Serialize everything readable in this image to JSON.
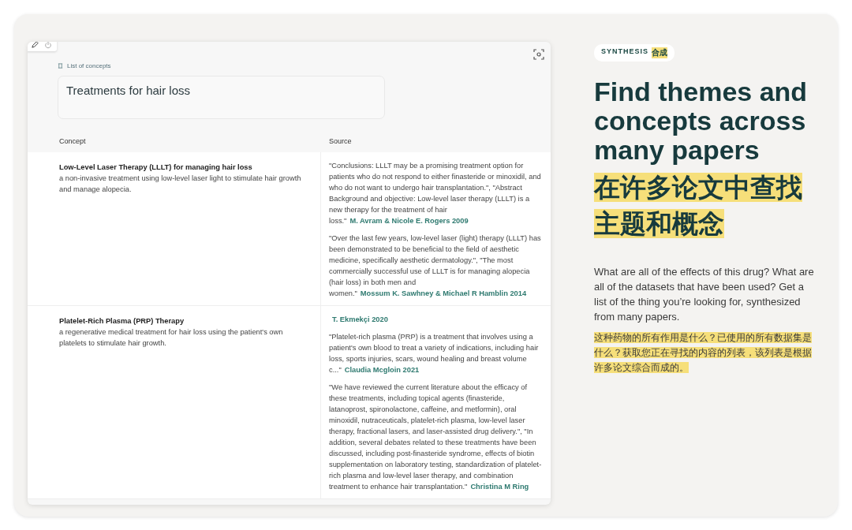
{
  "panel": {
    "breadcrumb": "List of concepts",
    "query": "Treatments for hair loss",
    "table": {
      "columns": [
        "Concept",
        "Source"
      ],
      "rows": [
        {
          "concept": "Low-Level Laser Therapy (LLLT) for managing hair loss",
          "description": "a non-invasive treatment using low-level laser light to stimulate hair growth and manage alopecia.",
          "sources": [
            {
              "quote": "\"Conclusions: LLLT may be a promising treatment option for patients who do not respond to either finasteride or minoxidil, and who do not want to undergo hair transplantation.\", \"Abstract Background and objective: Low-level laser therapy (LLLT) is a new therapy for the treatment of hair loss.\"",
              "author": "M. Avram & Nicole E. Rogers 2009"
            },
            {
              "quote": "\"Over the last few years, low-level laser (light) therapy (LLLT) has been demonstrated to be beneficial to the field of aesthetic medicine, specifically aesthetic dermatology.\", \"The most commercially successful use of LLLT is for managing alopecia (hair loss) in both men and women.\"",
              "author": "Mossum K. Sawhney & Michael R Hamblin 2014"
            }
          ]
        },
        {
          "concept": "Platelet-Rich Plasma (PRP) Therapy",
          "description": "a regenerative medical treatment for hair loss using the patient's own platelets to stimulate hair growth.",
          "sources": [
            {
              "author": "T. Ekmekçi 2020"
            },
            {
              "quote": "\"Platelet-rich plasma (PRP) is a treatment that involves using a patient's own blood to treat a variety of indications, including hair loss, sports injuries, scars, wound healing and breast volume c...\"",
              "author": "Claudia Mcgloin 2021"
            },
            {
              "quote": "\"We have reviewed the current literature about the efficacy of these treatments, including topical agents (finasteride, latanoprost, spironolactone, caffeine, and metformin), oral minoxidil, nutraceuticals, platelet-rich plasma, low-level laser therapy, fractional lasers, and laser-assisted drug delivery.\", \"In addition, several debates related to these treatments have been discussed, including post-finasteride syndrome, effects of biotin supplementation on laboratory testing, standardization of platelet-rich plasma and low-level laser therapy, and combination treatment to enhance hair transplantation.\"",
              "author": "Christina M Ring"
            }
          ]
        }
      ]
    }
  },
  "promo": {
    "badge": "SYNTHESIS",
    "badge_cn": "合成",
    "title": "Find themes and concepts across many papers",
    "title_cn": "在许多论文中查找主题和概念",
    "body": "What are all of the effects of this drug? What are all of the datasets that have been used? Get a list of the thing you’re looking for, synthesized from many papers.",
    "body_cn": "这种药物的所有作用是什么？已使用的所有数据集是什么？获取您正在寻找的内容的列表，该列表是根据许多论文综合而成的。"
  }
}
